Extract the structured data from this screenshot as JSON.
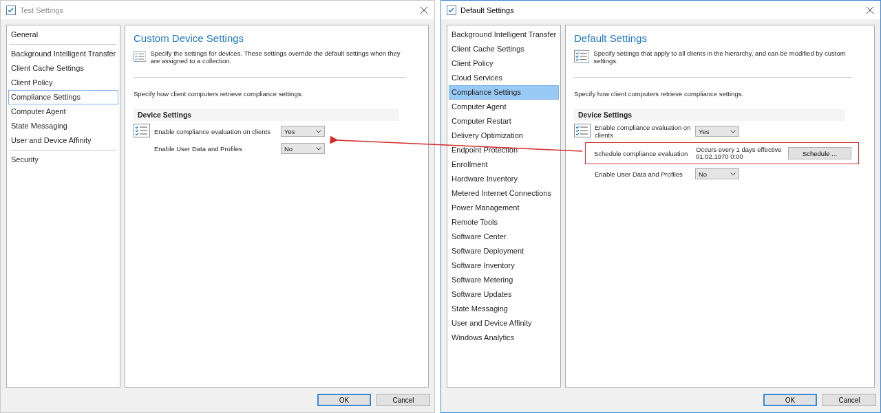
{
  "windows": [
    {
      "title": "Test Settings",
      "active": false,
      "sidebar": {
        "groups": [
          [
            {
              "label": "General",
              "selected": false
            }
          ],
          [
            {
              "label": "Background Intelligent Transfer",
              "selected": false
            },
            {
              "label": "Client Cache Settings",
              "selected": false
            },
            {
              "label": "Client Policy",
              "selected": false
            },
            {
              "label": "Compliance Settings",
              "selected": true
            },
            {
              "label": "Computer Agent",
              "selected": false
            },
            {
              "label": "State Messaging",
              "selected": false
            },
            {
              "label": "User and Device Affinity",
              "selected": false
            }
          ],
          [
            {
              "label": "Security",
              "selected": false
            }
          ]
        ]
      },
      "heading": "Custom Device Settings",
      "intro": "Specify the settings for devices. These settings override the default settings when they are assigned to a collection.",
      "description": "Specify how client computers retrieve compliance settings.",
      "section": "Device Settings",
      "settings": [
        {
          "kind": "select",
          "label": "Enable compliance evaluation on clients",
          "value": "Yes",
          "highlighted": false
        },
        {
          "kind": "select",
          "label": "Enable User Data and Profiles",
          "value": "No",
          "highlighted": false
        }
      ],
      "buttons": [
        {
          "label": "OK",
          "default": true
        },
        {
          "label": "Cancel",
          "default": false
        }
      ]
    },
    {
      "title": "Default Settings",
      "active": true,
      "sidebar": {
        "groups": [
          [
            {
              "label": "Background Intelligent Transfer",
              "selected": false
            },
            {
              "label": "Client Cache Settings",
              "selected": false
            },
            {
              "label": "Client Policy",
              "selected": false
            },
            {
              "label": "Cloud Services",
              "selected": false
            },
            {
              "label": "Compliance Settings",
              "selected": true
            },
            {
              "label": "Computer Agent",
              "selected": false
            },
            {
              "label": "Computer Restart",
              "selected": false
            },
            {
              "label": "Delivery Optimization",
              "selected": false
            },
            {
              "label": "Endpoint Protection",
              "selected": false
            },
            {
              "label": "Enrollment",
              "selected": false
            },
            {
              "label": "Hardware Inventory",
              "selected": false
            },
            {
              "label": "Metered Internet Connections",
              "selected": false
            },
            {
              "label": "Power Management",
              "selected": false
            },
            {
              "label": "Remote Tools",
              "selected": false
            },
            {
              "label": "Software Center",
              "selected": false
            },
            {
              "label": "Software Deployment",
              "selected": false
            },
            {
              "label": "Software Inventory",
              "selected": false
            },
            {
              "label": "Software Metering",
              "selected": false
            },
            {
              "label": "Software Updates",
              "selected": false
            },
            {
              "label": "State Messaging",
              "selected": false
            },
            {
              "label": "User and Device Affinity",
              "selected": false
            },
            {
              "label": "Windows Analytics",
              "selected": false
            }
          ]
        ]
      },
      "heading": "Default Settings",
      "intro": "Specify settings that apply to all clients in the hierarchy, and can be modified by custom settings.",
      "description": "Specify how client computers retrieve compliance settings.",
      "section": "Device Settings",
      "settings": [
        {
          "kind": "select",
          "label": "Enable compliance evaluation on clients",
          "value": "Yes",
          "highlighted": false
        },
        {
          "kind": "schedule",
          "label": "Schedule compliance evaluation",
          "value": "Occurs every 1 days effective 01.02.1970 0:00",
          "button": "Schedule ...",
          "highlighted": true
        },
        {
          "kind": "select",
          "label": "Enable User Data and Profiles",
          "value": "No",
          "highlighted": false
        }
      ],
      "buttons": [
        {
          "label": "OK",
          "default": true
        },
        {
          "label": "Cancel",
          "default": false
        }
      ]
    }
  ]
}
